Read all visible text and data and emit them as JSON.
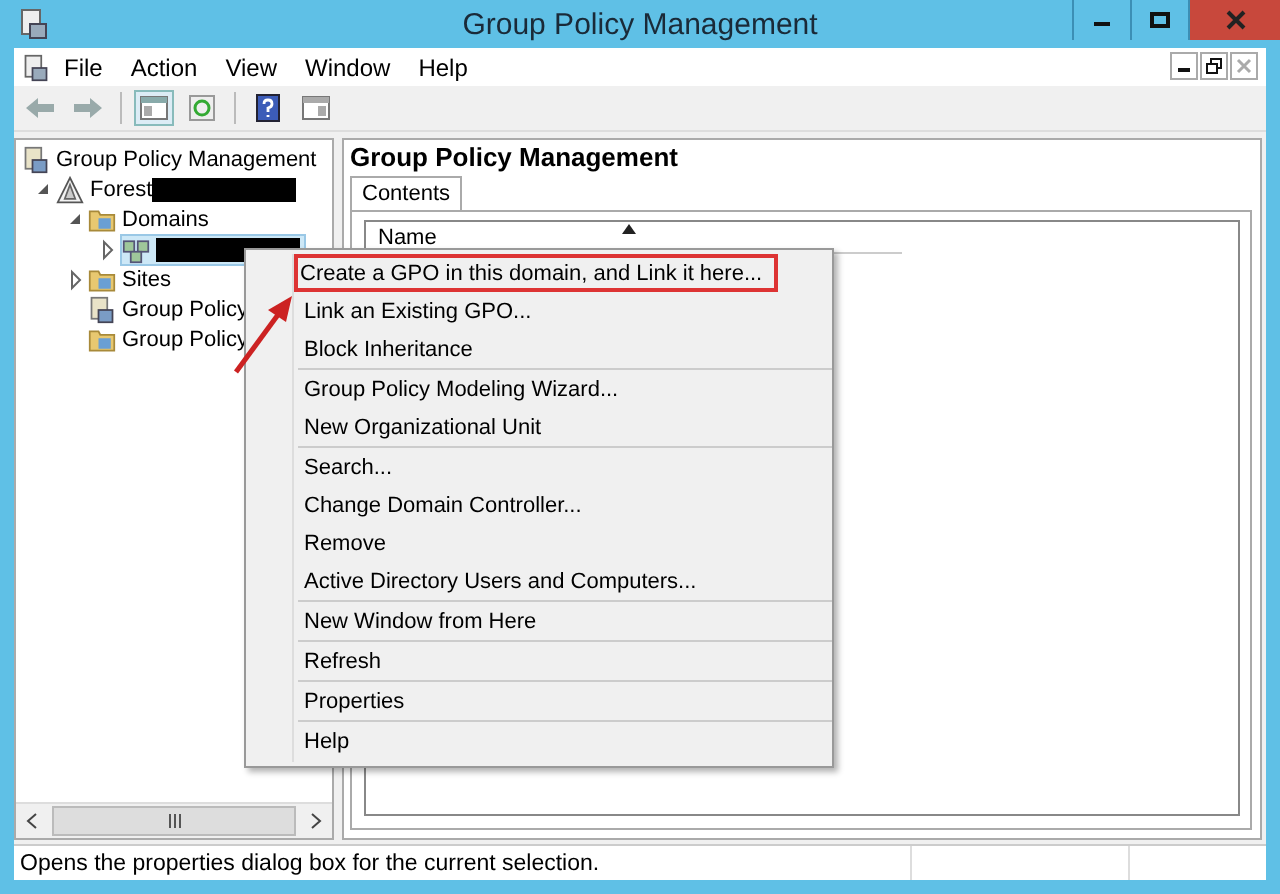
{
  "window": {
    "title": "Group Policy Management"
  },
  "menu_bar": [
    "File",
    "Action",
    "View",
    "Window",
    "Help"
  ],
  "tree": [
    {
      "label": "Group Policy Management",
      "children": [
        {
          "label": "Forest",
          "redacted": true,
          "expanded": true,
          "children": [
            {
              "label": "Domains",
              "expanded": true,
              "children": [
                {
                  "redacted": true,
                  "expanded": false,
                  "selected": true
                }
              ]
            },
            {
              "label": "Sites",
              "expanded": false
            },
            {
              "label": "Group Policy"
            },
            {
              "label": "Group Policy"
            }
          ]
        }
      ]
    }
  ],
  "content": {
    "title": "Group Policy Management",
    "tabs": [
      {
        "label": "Contents",
        "selected": true
      }
    ],
    "columns": [
      {
        "label": "Name",
        "sorted": true
      }
    ]
  },
  "context_menu": {
    "groups": [
      [
        {
          "label": "Create a GPO in this domain, and Link it here...",
          "callout": true
        },
        {
          "label": "Link an Existing GPO...",
          "callout": false
        },
        {
          "label": "Block Inheritance",
          "callout": false
        }
      ],
      [
        {
          "label": "Group Policy Modeling Wizard...",
          "callout": false
        },
        {
          "label": "New Organizational Unit",
          "callout": false
        }
      ],
      [
        {
          "label": "Search...",
          "callout": false
        },
        {
          "label": "Change Domain Controller...",
          "callout": false
        },
        {
          "label": "Remove",
          "callout": false
        },
        {
          "label": "Active Directory Users and Computers...",
          "callout": false
        }
      ],
      [
        {
          "label": "New Window from Here",
          "callout": false
        }
      ],
      [
        {
          "label": "Refresh",
          "callout": false
        }
      ],
      [
        {
          "label": "Properties",
          "callout": false
        }
      ],
      [
        {
          "label": "Help",
          "callout": false
        }
      ]
    ]
  },
  "status_bar": {
    "text": "Opens the properties dialog box for the current selection."
  }
}
